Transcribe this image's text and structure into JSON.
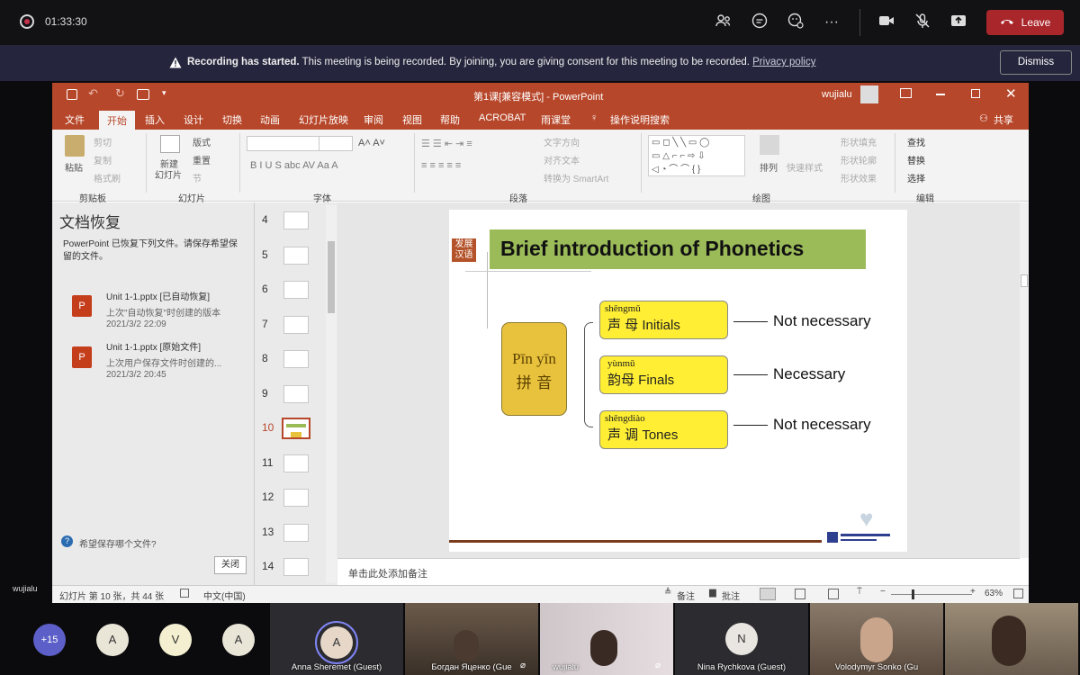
{
  "meeting": {
    "timer": "01:33:30",
    "leave_label": "Leave",
    "icons": [
      "people-icon",
      "chat-icon",
      "reactions-icon",
      "more-icon",
      "camera-icon",
      "mic-off-icon",
      "share-icon",
      "phone-icon"
    ]
  },
  "banner": {
    "bold": "Recording has started.",
    "text": " This meeting is being recorded. By joining, you are giving consent for this meeting to be recorded. ",
    "link": "Privacy policy",
    "dismiss_label": "Dismiss"
  },
  "ppt": {
    "title": "第1课[兼容模式]  -  PowerPoint",
    "user": "wujialu",
    "tabs": [
      "文件",
      "开始",
      "插入",
      "设计",
      "切换",
      "动画",
      "幻灯片放映",
      "审阅",
      "视图",
      "帮助",
      "ACROBAT",
      "雨课堂",
      "操作说明搜索"
    ],
    "share": "共享",
    "ribbon": {
      "paste": "粘贴",
      "cut": "剪切",
      "copy": "复制",
      "format_painter": "格式刷",
      "clipboard": "剪贴板",
      "new_slide_1": "新建",
      "new_slide_2": "幻灯片",
      "layout": "版式",
      "reset": "重置",
      "section": "节",
      "slides": "幻灯片",
      "font": "字体",
      "text_direction": "文字方向",
      "align_text": "对齐文本",
      "smartart": "转换为 SmartArt",
      "paragraph": "段落",
      "arrange": "排列",
      "quick_styles": "快速样式",
      "shape_fill": "形状填充",
      "shape_outline": "形状轮廓",
      "shape_effects": "形状效果",
      "drawing": "绘图",
      "find": "查找",
      "replace": "替换",
      "select": "选择",
      "editing": "编辑"
    },
    "recovery": {
      "title": "文档恢复",
      "desc": "PowerPoint 已恢复下列文件。请保存希望保留的文件。",
      "files": [
        {
          "name": "Unit 1-1.pptx  [已自动恢复]",
          "sub": "上次\"自动恢复\"时创建的版本",
          "time": "2021/3/2 22:09"
        },
        {
          "name": "Unit 1-1.pptx  [原始文件]",
          "sub": "上次用户保存文件时创建的...",
          "time": "2021/3/2 20:45"
        }
      ],
      "help": "希望保存哪个文件?",
      "close": "关闭"
    },
    "thumbs": [
      "4",
      "5",
      "6",
      "7",
      "8",
      "9",
      "10",
      "11",
      "12",
      "13",
      "14"
    ],
    "active_thumb": "10",
    "notes_placeholder": "单击此处添加备注",
    "status": {
      "slide_info": "幻灯片 第 10 张，共 44 张",
      "lang": "中文(中国)",
      "notes": "备注",
      "comments": "批注",
      "zoom": "63%"
    }
  },
  "slide": {
    "badge_1": "发展",
    "badge_2": "汉语",
    "title": "Brief introduction of Phonetics",
    "pinyin_1": "Pīn yīn",
    "pinyin_2": "拼  音",
    "items": [
      {
        "pinyin": "shēngmǔ",
        "label": "声  母  Initials",
        "note": "Not necessary"
      },
      {
        "pinyin": "yùnmǔ",
        "label": "韵母  Finals",
        "note": "Necessary"
      },
      {
        "pinyin": "shēngdiào",
        "label": "声    调   Tones",
        "note": "Not necessary"
      }
    ]
  },
  "presenter_label": "wujialu",
  "gallery": {
    "overflow": "+15",
    "avatars": [
      "A",
      "V",
      "A"
    ],
    "tiles": [
      {
        "name": "Anna Sheremet (Guest)",
        "initial": "A"
      },
      {
        "name": "Богдан Яценко (Gue"
      },
      {
        "name": "wujialu"
      },
      {
        "name": "Nina Rychkova (Guest)",
        "initial": "N"
      },
      {
        "name": "Volodymyr Sonko (Gu"
      },
      {
        "name": ""
      }
    ]
  }
}
